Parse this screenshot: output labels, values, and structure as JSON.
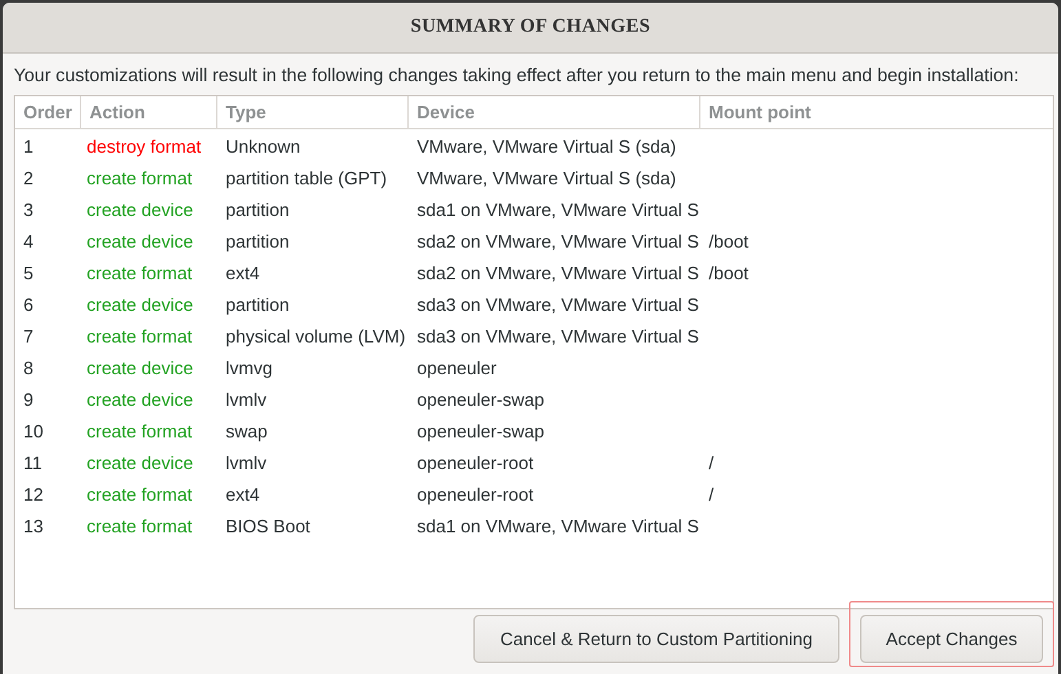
{
  "window": {
    "title": "SUMMARY OF CHANGES"
  },
  "description": "Your customizations will result in the following changes taking effect after you return to the main menu and begin installation:",
  "table": {
    "columns": [
      "Order",
      "Action",
      "Type",
      "Device",
      "Mount point"
    ],
    "rows": [
      {
        "order": "1",
        "action": "destroy format",
        "kind": "destroy",
        "type": "Unknown",
        "device": "VMware, VMware Virtual S (sda)",
        "mount_point": ""
      },
      {
        "order": "2",
        "action": "create format",
        "kind": "create",
        "type": "partition table (GPT)",
        "device": "VMware, VMware Virtual S (sda)",
        "mount_point": ""
      },
      {
        "order": "3",
        "action": "create device",
        "kind": "create",
        "type": "partition",
        "device": "sda1 on VMware, VMware Virtual S",
        "mount_point": ""
      },
      {
        "order": "4",
        "action": "create device",
        "kind": "create",
        "type": "partition",
        "device": "sda2 on VMware, VMware Virtual S",
        "mount_point": "/boot"
      },
      {
        "order": "5",
        "action": "create format",
        "kind": "create",
        "type": "ext4",
        "device": "sda2 on VMware, VMware Virtual S",
        "mount_point": "/boot"
      },
      {
        "order": "6",
        "action": "create device",
        "kind": "create",
        "type": "partition",
        "device": "sda3 on VMware, VMware Virtual S",
        "mount_point": ""
      },
      {
        "order": "7",
        "action": "create format",
        "kind": "create",
        "type": "physical volume (LVM)",
        "device": "sda3 on VMware, VMware Virtual S",
        "mount_point": ""
      },
      {
        "order": "8",
        "action": "create device",
        "kind": "create",
        "type": "lvmvg",
        "device": "openeuler",
        "mount_point": ""
      },
      {
        "order": "9",
        "action": "create device",
        "kind": "create",
        "type": "lvmlv",
        "device": "openeuler-swap",
        "mount_point": ""
      },
      {
        "order": "10",
        "action": "create format",
        "kind": "create",
        "type": "swap",
        "device": "openeuler-swap",
        "mount_point": ""
      },
      {
        "order": "11",
        "action": "create device",
        "kind": "create",
        "type": "lvmlv",
        "device": "openeuler-root",
        "mount_point": "/"
      },
      {
        "order": "12",
        "action": "create format",
        "kind": "create",
        "type": "ext4",
        "device": "openeuler-root",
        "mount_point": "/"
      },
      {
        "order": "13",
        "action": "create format",
        "kind": "create",
        "type": "BIOS Boot",
        "device": "sda1 on VMware, VMware Virtual S",
        "mount_point": ""
      }
    ]
  },
  "buttons": [
    {
      "label": "Cancel & Return to Custom Partitioning",
      "highlighted": false
    },
    {
      "label": "Accept Changes",
      "highlighted": true
    }
  ]
}
